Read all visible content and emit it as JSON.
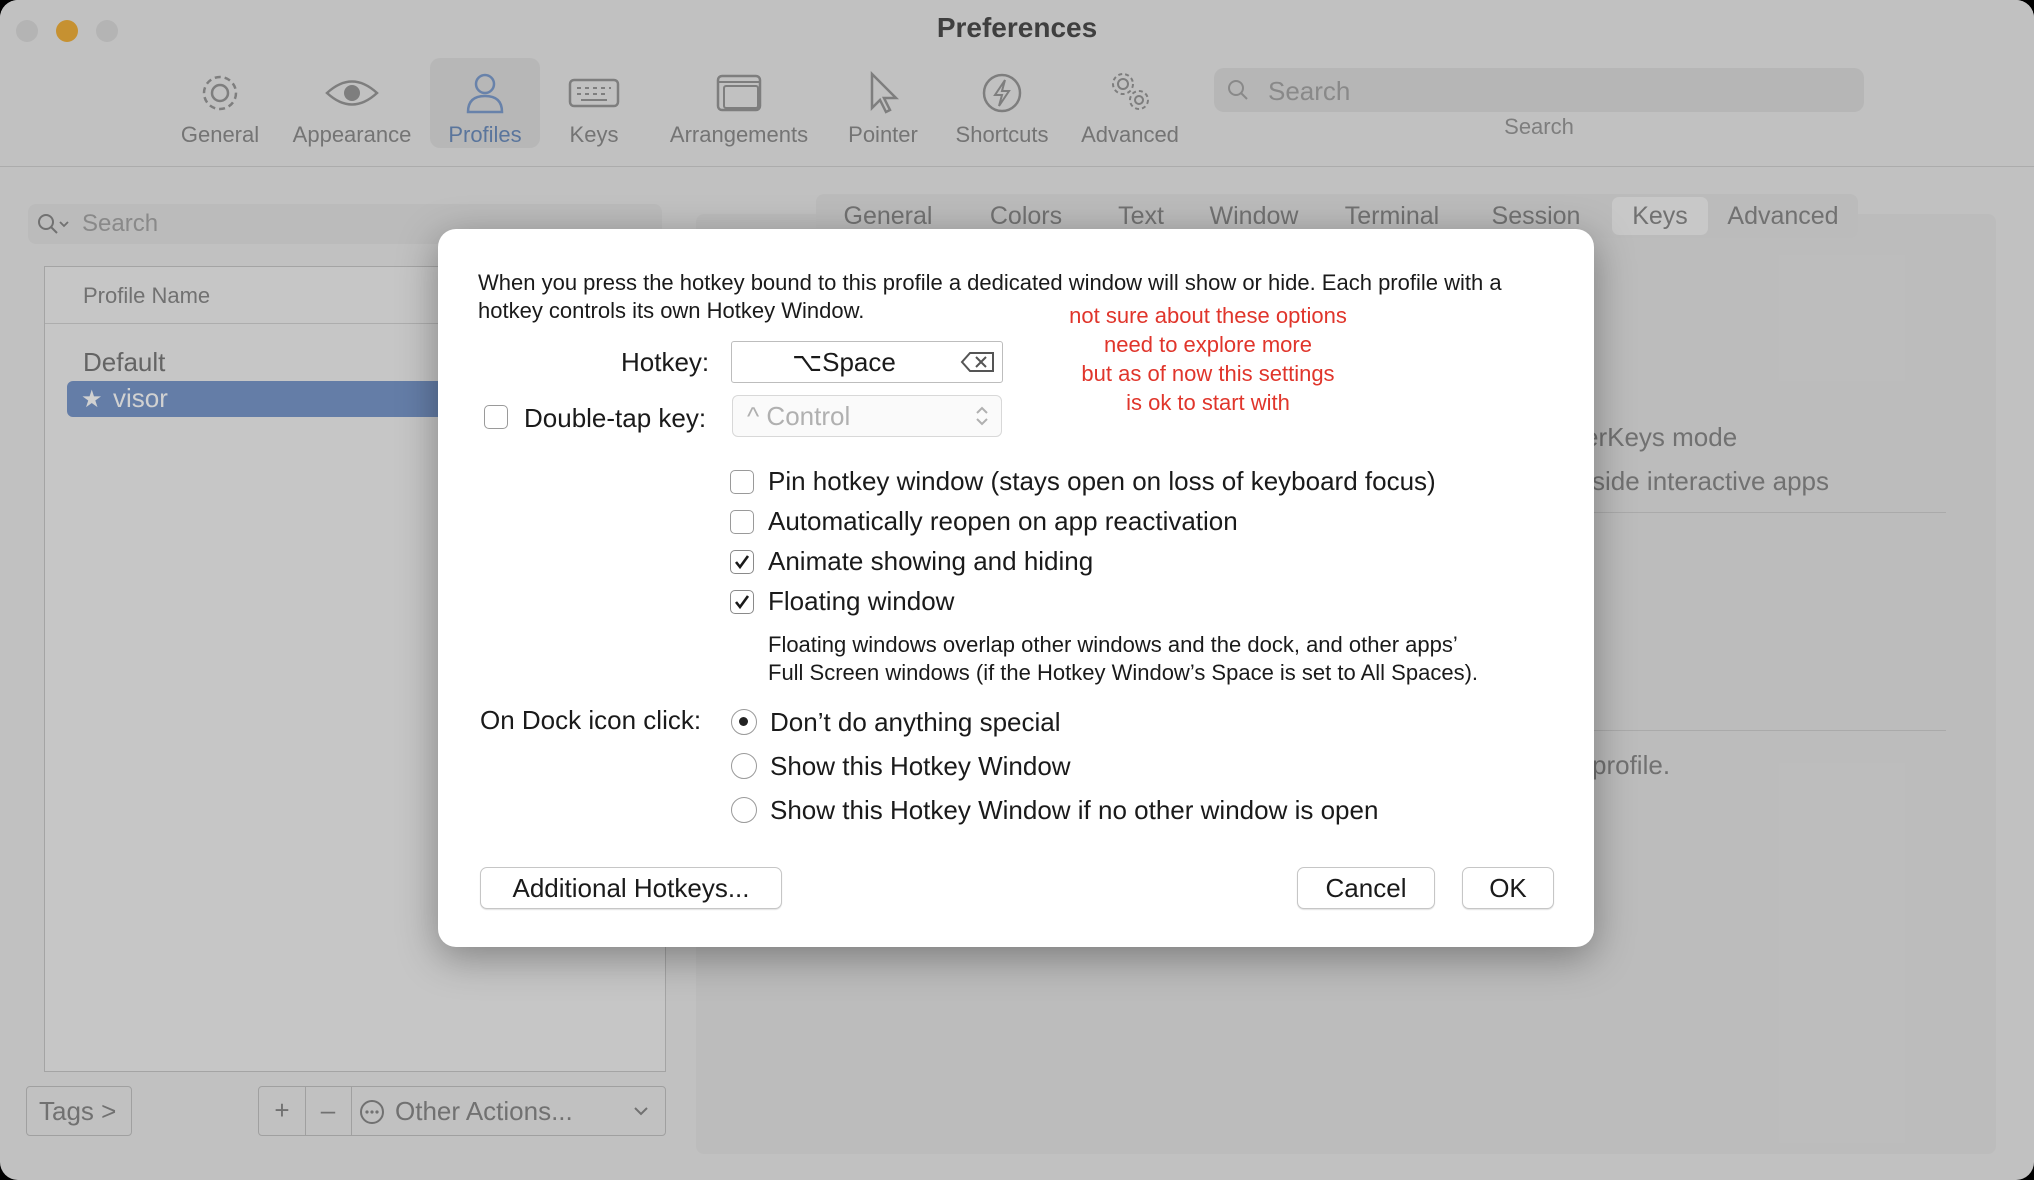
{
  "window": {
    "title": "Preferences",
    "traffic_lights": [
      "#dcdcdc",
      "#f2b13c",
      "#dcdcdc"
    ]
  },
  "toolbar": {
    "items": [
      {
        "label": "General",
        "icon": "gear-icon"
      },
      {
        "label": "Appearance",
        "icon": "eye-icon"
      },
      {
        "label": "Profiles",
        "icon": "person-icon",
        "selected": true
      },
      {
        "label": "Keys",
        "icon": "keyboard-icon"
      },
      {
        "label": "Arrangements",
        "icon": "windows-icon"
      },
      {
        "label": "Pointer",
        "icon": "pointer-icon"
      },
      {
        "label": "Shortcuts",
        "icon": "lightning-icon"
      },
      {
        "label": "Advanced",
        "icon": "gears-icon"
      }
    ],
    "search_placeholder": "Search",
    "search_label": "Search"
  },
  "profiles": {
    "search_placeholder": "Search",
    "column_header": "Profile Name",
    "rows": [
      {
        "name": "Default"
      },
      {
        "name": "visor",
        "selected": true,
        "starred": true
      }
    ],
    "tags_button": "Tags >",
    "add_button": "+",
    "remove_button": "–",
    "other_actions": "Other Actions..."
  },
  "profile_tabs": {
    "tabs": [
      "General",
      "Colors",
      "Text",
      "Window",
      "Terminal",
      "Session",
      "Keys",
      "Advanced"
    ],
    "selected": "Keys"
  },
  "background_text": {
    "line1": "erKeys mode",
    "line2": "side interactive apps",
    "line3": "profile."
  },
  "dialog": {
    "intro": "When you press the hotkey bound to this profile a dedicated window will show or hide. Each profile with a hotkey controls its own Hotkey Window.",
    "hotkey_label": "Hotkey:",
    "hotkey_value": "⌥Space",
    "double_tap_label": "Double-tap key:",
    "double_tap_checked": false,
    "double_tap_value": "^ Control",
    "options": [
      {
        "label": "Pin hotkey window (stays open on loss of keyboard focus)",
        "checked": false
      },
      {
        "label": "Automatically reopen on app reactivation",
        "checked": false
      },
      {
        "label": "Animate showing and hiding",
        "checked": true
      },
      {
        "label": "Floating window",
        "checked": true
      }
    ],
    "floating_note_line1": "Floating windows overlap other windows and the dock, and other apps’",
    "floating_note_line2": "Full Screen windows (if the Hotkey Window’s Space is set to All Spaces).",
    "dock_label": "On Dock icon click:",
    "dock_options": [
      {
        "label": "Don’t do anything special",
        "selected": true
      },
      {
        "label": "Show this Hotkey Window",
        "selected": false
      },
      {
        "label": "Show this Hotkey Window if no other window is open",
        "selected": false
      }
    ],
    "additional_hotkeys_button": "Additional Hotkeys...",
    "cancel_button": "Cancel",
    "ok_button": "OK"
  },
  "annotation": {
    "line1": "not sure about these options",
    "line2": "need to explore more",
    "line3": "but as of now this settings",
    "line4": "is ok to start with",
    "color": "#e0352b"
  }
}
